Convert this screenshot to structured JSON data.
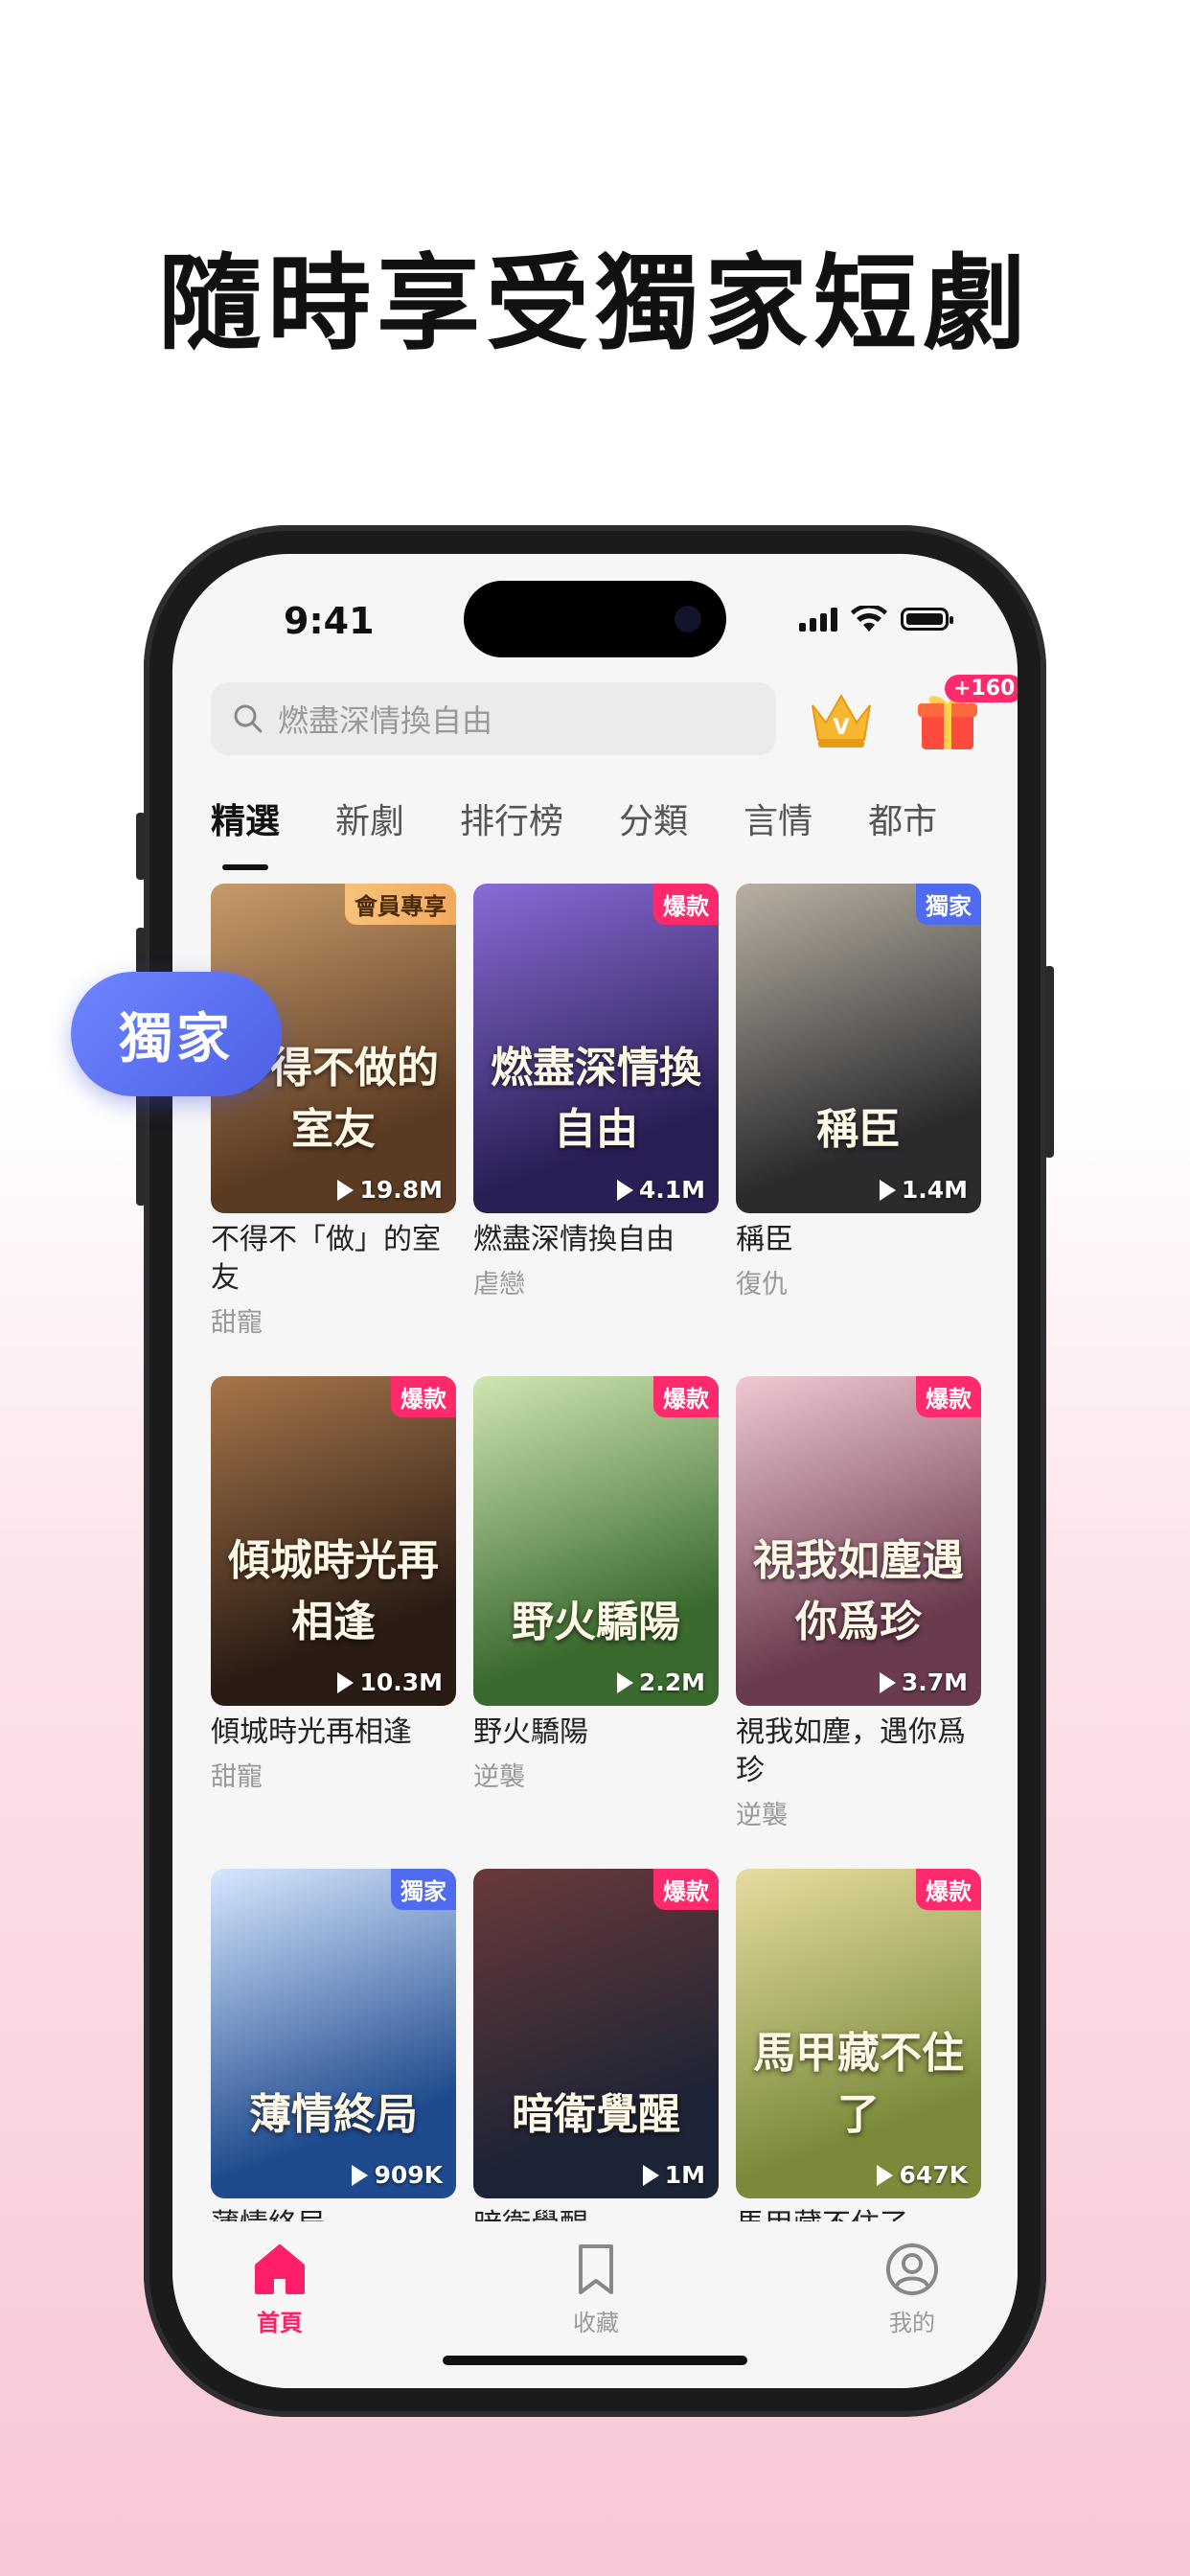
{
  "headline": "隨時享受獨家短劇",
  "status": {
    "time": "9:41"
  },
  "search": {
    "placeholder": "燃盡深情換自由"
  },
  "gift_badge": "+160",
  "tabs": [
    {
      "label": "精選",
      "active": true
    },
    {
      "label": "新劇"
    },
    {
      "label": "排行榜"
    },
    {
      "label": "分類"
    },
    {
      "label": "言情"
    },
    {
      "label": "都市"
    }
  ],
  "floating_pill": "獨家",
  "dramas": [
    {
      "name": "不得不「做」的室友",
      "genre": "甜寵",
      "views": "19.8M",
      "badge": "會員專享",
      "badge_type": "vip",
      "poster_text": "不得不做的室友",
      "colors": [
        "#5a3a22",
        "#c79a6a"
      ]
    },
    {
      "name": "燃盡深情換自由",
      "genre": "虐戀",
      "views": "4.1M",
      "badge": "爆款",
      "badge_type": "hot",
      "poster_text": "燃盡深情換自由",
      "colors": [
        "#2a1f55",
        "#8a6bd6"
      ]
    },
    {
      "name": "稱臣",
      "genre": "復仇",
      "views": "1.4M",
      "badge": "獨家",
      "badge_type": "excl",
      "poster_text": "稱臣",
      "colors": [
        "#2b2b2e",
        "#b9b0a2"
      ]
    },
    {
      "name": "傾城時光再相逢",
      "genre": "甜寵",
      "views": "10.3M",
      "badge": "爆款",
      "badge_type": "hot",
      "poster_text": "傾城時光再相逢",
      "colors": [
        "#2a1c14",
        "#a8764a"
      ]
    },
    {
      "name": "野火驕陽",
      "genre": "逆襲",
      "views": "2.2M",
      "badge": "爆款",
      "badge_type": "hot",
      "poster_text": "野火驕陽",
      "colors": [
        "#3a6a2e",
        "#cfe6b0"
      ]
    },
    {
      "name": "視我如塵，遇你爲珍",
      "genre": "逆襲",
      "views": "3.7M",
      "badge": "爆款",
      "badge_type": "hot",
      "poster_text": "視我如塵遇你爲珍",
      "colors": [
        "#6a3a4e",
        "#f1c8d2"
      ]
    },
    {
      "name": "薄情終局",
      "genre": "",
      "views": "909K",
      "badge": "獨家",
      "badge_type": "excl",
      "poster_text": "薄情終局",
      "colors": [
        "#1f4b8e",
        "#d6e6ff"
      ]
    },
    {
      "name": "暗衛覺醒",
      "genre": "",
      "views": "1M",
      "badge": "爆款",
      "badge_type": "hot",
      "poster_text": "暗衛覺醒",
      "colors": [
        "#1c2436",
        "#6a3a3a"
      ]
    },
    {
      "name": "馬甲藏不住了",
      "genre": "",
      "views": "647K",
      "badge": "爆款",
      "badge_type": "hot",
      "poster_text": "馬甲藏不住了",
      "colors": [
        "#7a8a3a",
        "#e6dca0"
      ]
    }
  ],
  "bottom_nav": [
    {
      "label": "首頁",
      "icon": "home-icon",
      "active": true
    },
    {
      "label": "收藏",
      "icon": "bookmark-icon"
    },
    {
      "label": "我的",
      "icon": "profile-icon"
    }
  ],
  "colors": {
    "accent": "#ff1f68",
    "hot_badge": "#ff2a6b",
    "exclusive_badge": "#4f6bf0"
  }
}
